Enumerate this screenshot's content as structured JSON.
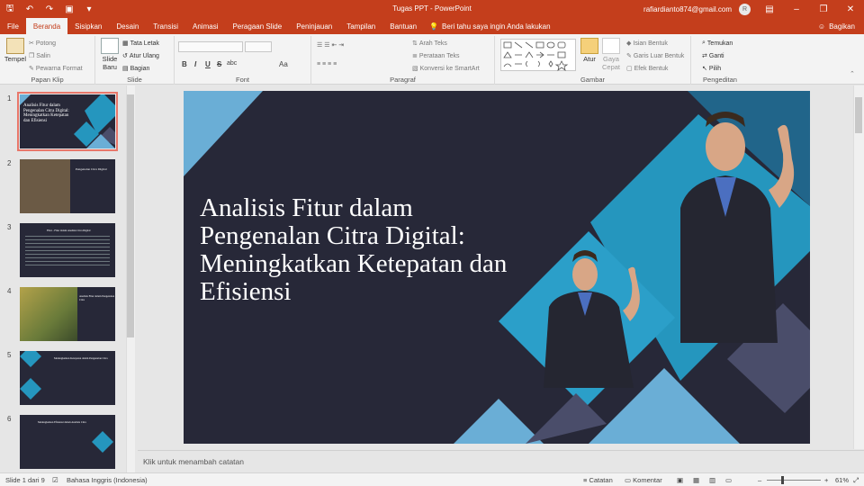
{
  "app": {
    "title": "Tugas PPT  -  PowerPoint",
    "user_email": "rafiardianto874@gmail.com",
    "avatar_letter": "R",
    "accent": "#c43e1c"
  },
  "tabs": [
    "File",
    "Beranda",
    "Sisipkan",
    "Desain",
    "Transisi",
    "Animasi",
    "Peragaan Slide",
    "Peninjauan",
    "Tampilan",
    "Bantuan"
  ],
  "tell_me": "Beri tahu saya ingin Anda lakukan",
  "share": "Bagikan",
  "ribbon": {
    "clipboard": {
      "label": "Papan Klip",
      "paste": "Tempel",
      "cut": "Potong",
      "copy": "Salin",
      "painter": "Pewarna Format"
    },
    "slides": {
      "label": "Slide",
      "new": "Slide Baru",
      "layout": "Tata Letak",
      "reset": "Atur Ulang",
      "section": "Bagian"
    },
    "font": {
      "label": "Font",
      "bold": "B",
      "italic": "I",
      "underline": "U",
      "strike": "S",
      "spacing": "abc",
      "case": "Aa"
    },
    "paragraph": {
      "label": "Paragraf",
      "direction": "Arah Teks",
      "align": "Perataan Teks",
      "smartart": "Konversi ke SmartArt"
    },
    "drawing": {
      "label": "Gambar",
      "arrange": "Atur",
      "styles": "Gaya Cepat",
      "fill": "Isian Bentuk",
      "outline": "Garis Luar Bentuk",
      "effects": "Efek Bentuk"
    },
    "editing": {
      "label": "Pengeditan",
      "find": "Temukan",
      "replace": "Ganti",
      "select": "Pilih"
    }
  },
  "thumbnails": [
    {
      "num": "1",
      "title": "Analisis Fitur dalam Pengenalan Citra Digital: Meningkatkan Ketepatan dan Efisiensi"
    },
    {
      "num": "2",
      "title": "Pengenalan Citra Digital"
    },
    {
      "num": "3",
      "title": "Fitur - Fitur dalam Analisis Citra Digital"
    },
    {
      "num": "4",
      "title": "Analisis Fitur dalam Pengenalan Citra"
    },
    {
      "num": "5",
      "title": "Meningkatkan Ketepatan dalam Pengenalan Citra"
    },
    {
      "num": "6",
      "title": "Meningkatkan Efisiensi dalam Analisis Citra"
    }
  ],
  "slide": {
    "title": "Analisis Fitur dalam Pengenalan Citra Digital: Meningkatkan Ketepatan dan Efisiensi"
  },
  "notes_placeholder": "Klik untuk menambah catatan",
  "status": {
    "slide_of": "Slide 1 dari 9",
    "language": "Bahasa Inggris (Indonesia)",
    "notes": "Catatan",
    "comments": "Komentar",
    "zoom": "61%"
  }
}
